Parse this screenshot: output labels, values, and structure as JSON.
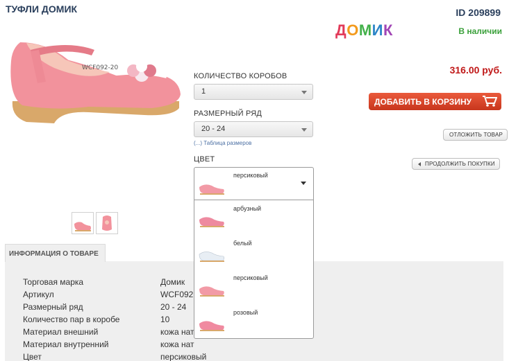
{
  "product": {
    "title": "ТУФЛИ ДОМИК",
    "id_label": "ID 209899",
    "brand": [
      "Д",
      "О",
      "М",
      "И",
      "К"
    ],
    "brand_colors": [
      "#e23b5a",
      "#f39a1c",
      "#43b04a",
      "#2d86c8",
      "#a145b5"
    ],
    "stock": "В наличии",
    "price": "316.00 руб."
  },
  "form": {
    "boxes_label": "КОЛИЧЕСТВО КОРОБОВ",
    "boxes_value": "1",
    "size_label": "РАЗМЕРНЫЙ РЯД",
    "size_value": "20 - 24",
    "size_table_link": "(...) Таблица размеров",
    "color_label": "ЦВЕТ",
    "color_value": "персиковый",
    "color_options": [
      {
        "label": "арбузный",
        "color": "#ee8aa0"
      },
      {
        "label": "белый",
        "color": "#e8eef4"
      },
      {
        "label": "персиковый",
        "color": "#f29aa6"
      },
      {
        "label": "розовый",
        "color": "#f08aa0"
      }
    ]
  },
  "actions": {
    "add_to_cart": "ДОБАВИТЬ В КОРЗИНУ",
    "postpone": "ОТЛОЖИТЬ ТОВАР",
    "continue": "ПРОДОЛЖИТЬ ПОКУПКИ"
  },
  "info": {
    "tab": "ИНФОРМАЦИЯ О ТОВАРЕ",
    "rows": [
      {
        "k": "Торговая марка",
        "v": "Домик"
      },
      {
        "k": "Артикул",
        "v": "WCF092"
      },
      {
        "k": "Размерный ряд",
        "v": "20 - 24"
      },
      {
        "k": "Количество пар в коробе",
        "v": "10"
      },
      {
        "k": "Материал внешний",
        "v": "кожа нат"
      },
      {
        "k": "Материал внутренний",
        "v": "кожа нат"
      },
      {
        "k": "Цвет",
        "v": "персиковый"
      }
    ]
  }
}
